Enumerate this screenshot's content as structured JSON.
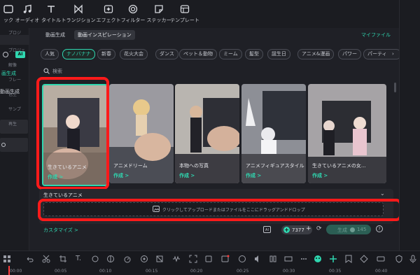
{
  "toolbar": {
    "items": [
      {
        "label": "ック",
        "icon": "media-icon"
      },
      {
        "label": "オーディオ",
        "icon": "music-note-icon"
      },
      {
        "label": "タイトル",
        "icon": "text-t-icon"
      },
      {
        "label": "トランジション",
        "icon": "transition-icon"
      },
      {
        "label": "エフェクト",
        "icon": "effects-sparkle-icon"
      },
      {
        "label": "フィルター",
        "icon": "filter-icon"
      },
      {
        "label": "ステッカー",
        "icon": "sticker-icon"
      },
      {
        "label": "テンプレート",
        "icon": "template-icon"
      }
    ]
  },
  "sidebar": {
    "ai_badge": "AI",
    "item1": "画生成",
    "item2": "動画生成"
  },
  "panel": {
    "tabs": [
      "動画生成",
      "動画インスピレーション"
    ],
    "my_file": "マイファイル",
    "chips": [
      "人気",
      "ナノバナナ",
      "新春",
      "花火大会",
      "ダンス",
      "ペット＆動物",
      "ミーム",
      "髪型",
      "誕生日",
      "アニメ&漫画",
      "パワー",
      "パーティ"
    ],
    "search_placeholder": "検索",
    "cards": [
      {
        "caption": "生きているアニメ",
        "action": "作成 >"
      },
      {
        "caption": "アニメドリーム",
        "action": "作成 >"
      },
      {
        "caption": "本物への写真",
        "action": "作成 >"
      },
      {
        "caption": "アニメフィギュアスタイル",
        "action": "作成 >"
      },
      {
        "caption": "生きているアニメの女...",
        "action": "作成 >"
      }
    ],
    "selected_title": "生きているアニメ",
    "upload_text": "クリックしてアップロードまたはファイルをここにドラッグアンドドロップ",
    "customize": "カスタマイズ >",
    "credits": "7377",
    "generate": "生成",
    "generate_cost": "145"
  },
  "rightbar": {
    "items": [
      "プロジ",
      "プロジェ",
      "解像",
      "フレー",
      "色空",
      "サンプ",
      "再生"
    ]
  },
  "timeline": {
    "ticks": [
      "00:00",
      "00:05",
      "00:10",
      "00:15",
      "00:20",
      "00:25",
      "00:30",
      "00:35",
      "00:40"
    ]
  },
  "colors": {
    "accent": "#2fd7b0",
    "highlight_box": "#ff1a1a",
    "background": "#17181d"
  }
}
